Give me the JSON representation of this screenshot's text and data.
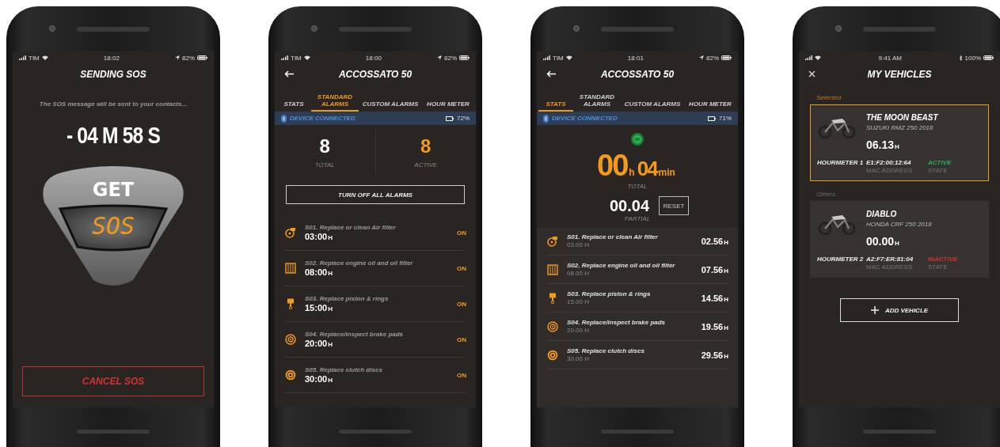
{
  "phones": [
    {
      "kind": "sos",
      "status_bar": {
        "carrier": "TIM",
        "time": "18:02",
        "battery": "82%",
        "bluetooth": false
      },
      "title": "SENDING SOS",
      "message": "The SOS message will be sent to your contacts...",
      "countdown": "- 04 M 58 S",
      "sos_button": {
        "top": "GET",
        "bottom": "SOS"
      },
      "cancel_button": "CANCEL SOS"
    },
    {
      "kind": "alarms",
      "status_bar": {
        "carrier": "TIM",
        "time": "18:00",
        "battery": "82%",
        "bluetooth": false
      },
      "title": "ACCOSSATO 50",
      "tabs": [
        {
          "label": "STATS",
          "selected": false
        },
        {
          "label": "STANDARD ALARMS",
          "selected": true
        },
        {
          "label": "CUSTOM ALARMS",
          "selected": false
        },
        {
          "label": "HOUR METER",
          "selected": false
        }
      ],
      "device": {
        "label": "DEVICE CONNECTED",
        "battery": "72%"
      },
      "stats": [
        {
          "value": "8",
          "label": "TOTAL",
          "highlight": false
        },
        {
          "value": "8",
          "label": "ACTIVE",
          "highlight": true
        }
      ],
      "button": "TURN OFF ALL ALARMS",
      "alarms": [
        {
          "name": "S01. Replace or clean Air filter",
          "hours": "03:00",
          "unit": "H",
          "status": "ON"
        },
        {
          "name": "S02. Replace engine oil and oil filter",
          "hours": "08:00",
          "unit": "H",
          "status": "ON"
        },
        {
          "name": "S03. Replace piston & rings",
          "hours": "15:00",
          "unit": "H",
          "status": "ON"
        },
        {
          "name": "S04. Replace/inspect brake pads",
          "hours": "20:00",
          "unit": "H",
          "status": "ON"
        },
        {
          "name": "S05. Replace clutch discs",
          "hours": "30:00",
          "unit": "H",
          "status": "ON"
        }
      ]
    },
    {
      "kind": "stats",
      "status_bar": {
        "carrier": "TIM",
        "time": "18:01",
        "battery": "82%",
        "bluetooth": false
      },
      "title": "ACCOSSATO 50",
      "tabs": [
        {
          "label": "STATS",
          "selected": true
        },
        {
          "label": "STANDARD ALARMS",
          "selected": false
        },
        {
          "label": "CUSTOM ALARMS",
          "selected": false
        },
        {
          "label": "HOUR METER",
          "selected": false
        }
      ],
      "device": {
        "label": "DEVICE CONNECTED",
        "battery": "71%"
      },
      "total": {
        "hours": "00",
        "hours_unit": "h",
        "minutes": "04",
        "minutes_unit": "min",
        "label": "TOTAL"
      },
      "partial": {
        "value": "00.04",
        "label": "PARTIAL",
        "reset": "RESET"
      },
      "items": [
        {
          "name": "S01. Replace or clean Air filter",
          "interval": "03.00 H",
          "value": "02.56",
          "unit": "H"
        },
        {
          "name": "S02. Replace engine oil and oil filter",
          "interval": "08.00 H",
          "value": "07.56",
          "unit": "H"
        },
        {
          "name": "S03. Replace piston & rings",
          "interval": "15.00 H",
          "value": "14.56",
          "unit": "H"
        },
        {
          "name": "S04. Replace/inspect brake pads",
          "interval": "20.00 H",
          "value": "19.56",
          "unit": "H"
        },
        {
          "name": "S05. Replace clutch discs",
          "interval": "30.00 H",
          "value": "29.56",
          "unit": "H"
        }
      ]
    },
    {
      "kind": "vehicles",
      "status_bar": {
        "time": "9:41 AM",
        "battery": "100%",
        "bluetooth": true
      },
      "title": "MY VEHICLES",
      "sections": [
        {
          "label": "Selected",
          "vehicles": [
            {
              "name": "THE MOON BEAST",
              "model": "SUZUKI RMZ 250 2018",
              "hours": "06.13",
              "unit": "H",
              "meter": "HOURMETER 1",
              "mac": "E1:F2:00:12:64",
              "mac_label": "MAC ADDRESS",
              "state": "ACTIVE",
              "state_label": "STATE",
              "active": true,
              "selected": true
            }
          ]
        },
        {
          "label": "Others",
          "vehicles": [
            {
              "name": "DIABLO",
              "model": "HONDA CRF 250 2018",
              "hours": "00.00",
              "unit": "H",
              "meter": "HOURMETER 2",
              "mac": "A2:F7:ER:81:04",
              "mac_label": "MAC ADDRESS",
              "state": "INACTIVE",
              "state_label": "STATE",
              "active": false,
              "selected": false
            }
          ]
        }
      ],
      "add_button": "ADD VEHICLE"
    }
  ]
}
